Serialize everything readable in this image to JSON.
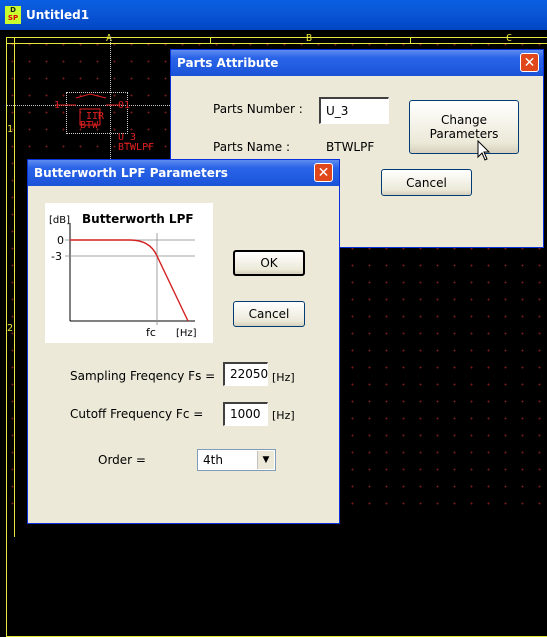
{
  "app": {
    "title": "Untitled1",
    "icon_top": "D",
    "icon_bottom": "SP"
  },
  "canvas": {
    "columns": [
      "A",
      "B",
      "C"
    ],
    "rows": [
      "1",
      "2"
    ],
    "part": {
      "pin_left": "1",
      "pin_right": "01",
      "symbol_top": "IIR",
      "symbol_bottom": "BTW",
      "ref": "U_3",
      "name": "BTWLPF"
    }
  },
  "parts_attribute": {
    "title": "Parts Attribute",
    "close_glyph": "✕",
    "parts_number_label": "Parts Number :",
    "parts_number_value": "U_3",
    "parts_name_label": "Parts Name :",
    "parts_name_value": "BTWLPF",
    "change_button_line1": "Change",
    "change_button_line2": "Parameters",
    "cancel_label": "Cancel"
  },
  "butterworth": {
    "title": "Butterworth LPF Parameters",
    "close_glyph": "✕",
    "ok_label": "OK",
    "cancel_label": "Cancel",
    "sampling_label": "Sampling Freqency Fs =",
    "sampling_value": "22050",
    "sampling_unit": "[Hz]",
    "cutoff_label": "Cutoff Frequency Fc =",
    "cutoff_value": "1000",
    "cutoff_unit": "[Hz]",
    "order_label": "Order =",
    "order_value": "4th",
    "plot": {
      "title": "Butterworth LPF",
      "y_unit": "[dB]",
      "y_tick_0": "0",
      "y_tick_minus3": "-3",
      "x_tick_fc": "fc",
      "x_unit": "[Hz]",
      "curve_color": "#d42020"
    }
  }
}
